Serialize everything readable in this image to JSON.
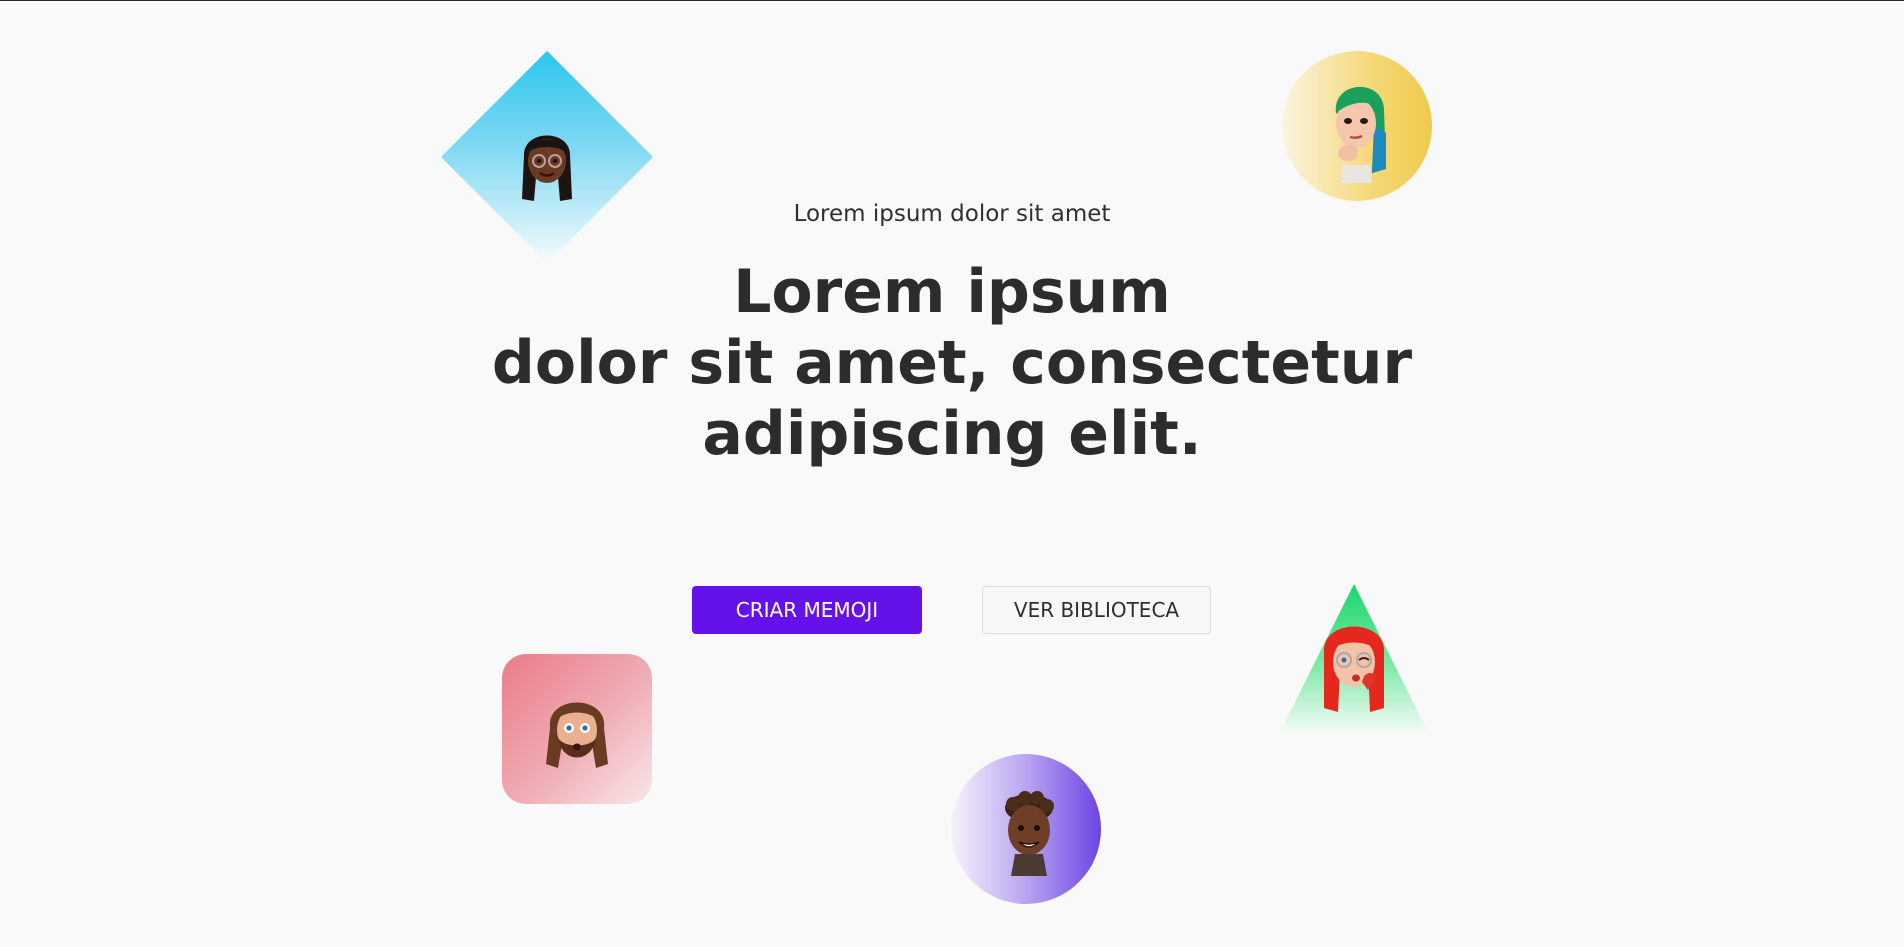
{
  "hero": {
    "eyebrow": "Lorem ipsum dolor sit amet",
    "headline_lines": [
      "Lorem ipsum",
      "dolor sit amet, consectetur",
      "adipiscing elit."
    ]
  },
  "actions": {
    "primary_label": "CRIAR MEMOJI",
    "secondary_label": "VER BIBLIOTECA"
  },
  "colors": {
    "background": "#f9f9f9",
    "primary": "#6512ea",
    "text": "#2c2c2c"
  },
  "decorations": [
    {
      "shape": "diamond",
      "color": "#2cc6ec",
      "avatar": "memoji-woman-braids-icon"
    },
    {
      "shape": "circle",
      "color": "#f0c94d",
      "avatar": "memoji-woman-green-hair-icon"
    },
    {
      "shape": "rounded-square",
      "color": "#ea7c89",
      "avatar": "memoji-man-beard-icon"
    },
    {
      "shape": "circle",
      "color": "#6d44e4",
      "avatar": "memoji-man-curly-hair-icon"
    },
    {
      "shape": "triangle",
      "color": "#1ad66b",
      "avatar": "memoji-woman-red-hair-icon"
    }
  ]
}
